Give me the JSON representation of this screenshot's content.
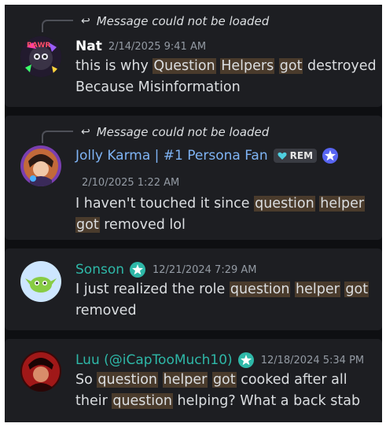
{
  "colors": {
    "name_white": "#ffffff",
    "name_blue": "#7fb4f5",
    "name_teal": "#2eb8a8",
    "highlight_bg": "#4a3b2c",
    "badge_blue": "#5865f2"
  },
  "messages": [
    {
      "reply_text": "Message could not be loaded",
      "author": "Nat",
      "timestamp": "2/14/2025 9:41 AM",
      "lines": [
        [
          {
            "t": "this is why "
          },
          {
            "t": "Question",
            "hl": true
          },
          {
            "t": " "
          },
          {
            "t": "Helpers",
            "hl": true
          },
          {
            "t": " "
          },
          {
            "t": "got",
            "hl": true
          },
          {
            "t": " destroyed"
          }
        ],
        [
          {
            "t": "Because Misinformation"
          }
        ]
      ]
    },
    {
      "reply_text": "Message could not be loaded",
      "author": "Jolly Karma | #1 Persona Fan",
      "tag_label": "REM",
      "badge_icon": "star-badge-icon",
      "timestamp": "2/10/2025 1:22 AM",
      "lines": [
        [
          {
            "t": "I haven't touched it since "
          },
          {
            "t": "question",
            "hl": true
          },
          {
            "t": " "
          },
          {
            "t": "helper",
            "hl": true
          }
        ],
        [
          {
            "t": "got",
            "hl": true
          },
          {
            "t": " removed lol"
          }
        ]
      ]
    },
    {
      "author": "Sonson",
      "badge_icon": "star-badge-icon",
      "timestamp": "12/21/2024 7:29 AM",
      "lines": [
        [
          {
            "t": "I just realized the role "
          },
          {
            "t": "question",
            "hl": true
          },
          {
            "t": " "
          },
          {
            "t": "helper",
            "hl": true
          },
          {
            "t": " "
          },
          {
            "t": "got",
            "hl": true
          }
        ],
        [
          {
            "t": "removed"
          }
        ]
      ]
    },
    {
      "author": "Luu (@iCapTooMuch10)",
      "badge_icon": "star-badge-icon",
      "timestamp": "12/18/2024 5:34 PM",
      "lines": [
        [
          {
            "t": "So "
          },
          {
            "t": "question",
            "hl": true
          },
          {
            "t": " "
          },
          {
            "t": "helper",
            "hl": true
          },
          {
            "t": " "
          },
          {
            "t": "got",
            "hl": true
          },
          {
            "t": " cooked after all"
          }
        ],
        [
          {
            "t": "their "
          },
          {
            "t": "question",
            "hl": true
          },
          {
            "t": " helping? What a back stab"
          }
        ]
      ]
    }
  ]
}
